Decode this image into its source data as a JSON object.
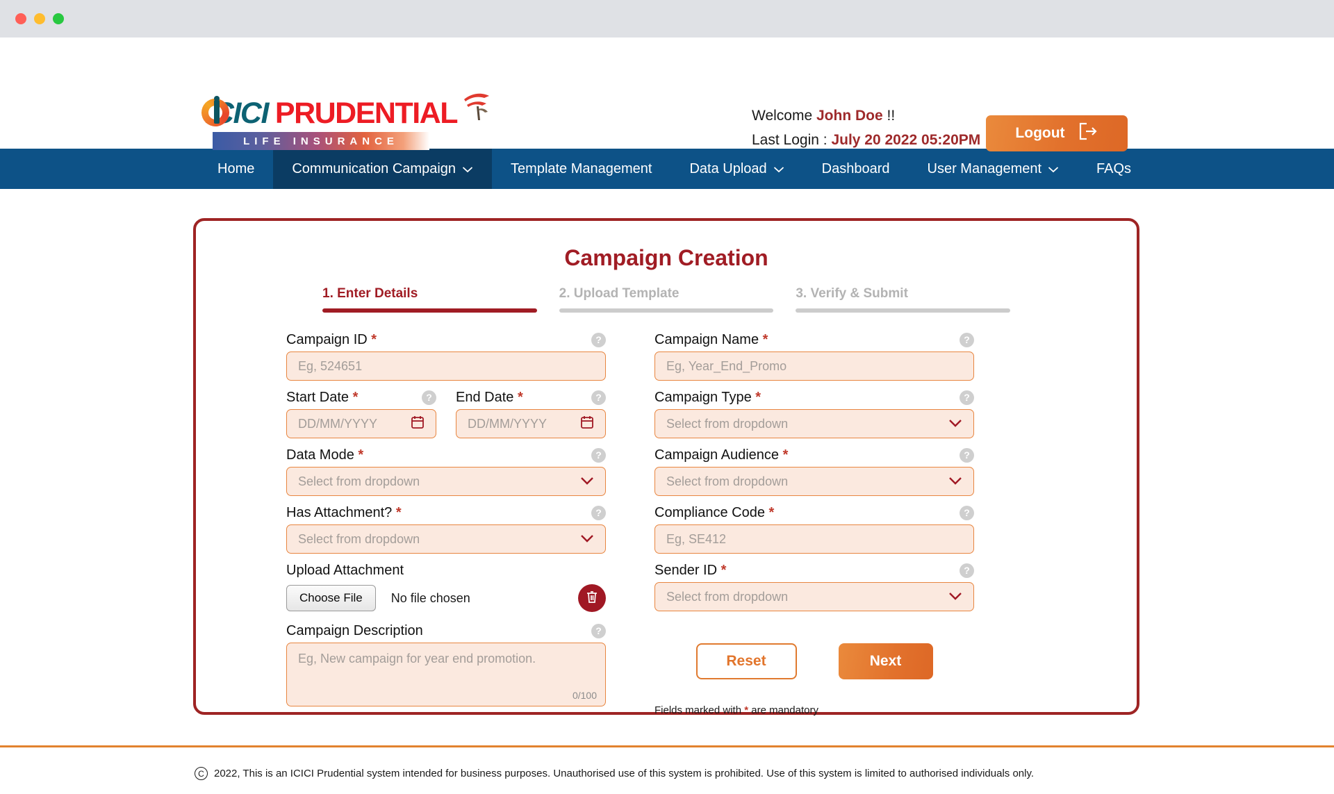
{
  "window": {
    "dots": [
      "close",
      "minimize",
      "maximize"
    ]
  },
  "header": {
    "brand": {
      "icici": "ICICI",
      "prudential": "PRUDENTIAL",
      "tagline": "LIFE INSURANCE"
    },
    "welcome_prefix": "Welcome",
    "user_name": "John Doe",
    "welcome_suffix": "!!",
    "last_login_label": "Last Login :",
    "last_login_value": "July 20 2022 05:20PM",
    "logout_label": "Logout"
  },
  "nav": {
    "items": [
      {
        "label": "Home",
        "caret": false,
        "active": false
      },
      {
        "label": "Communication Campaign",
        "caret": true,
        "active": true
      },
      {
        "label": "Template Management",
        "caret": false,
        "active": false
      },
      {
        "label": "Data Upload",
        "caret": true,
        "active": false
      },
      {
        "label": "Dashboard",
        "caret": false,
        "active": false
      },
      {
        "label": "User Management",
        "caret": true,
        "active": false
      },
      {
        "label": "FAQs",
        "caret": false,
        "active": false
      }
    ]
  },
  "card": {
    "title": "Campaign Creation",
    "steps": [
      {
        "label": "1. Enter Details",
        "active": true
      },
      {
        "label": "2. Upload Template",
        "active": false
      },
      {
        "label": "3. Verify & Submit",
        "active": false
      }
    ],
    "left": {
      "campaign_id": {
        "label": "Campaign ID",
        "required": "*",
        "placeholder": "Eg, 524651",
        "value": ""
      },
      "start_date": {
        "label": "Start Date",
        "required": "*",
        "placeholder": "DD/MM/YYYY",
        "value": ""
      },
      "end_date": {
        "label": "End Date",
        "required": "*",
        "placeholder": "DD/MM/YYYY",
        "value": ""
      },
      "data_mode": {
        "label": "Data Mode",
        "required": "*",
        "placeholder": "Select from dropdown",
        "value": ""
      },
      "has_attachment": {
        "label": "Has Attachment?",
        "required": "*",
        "placeholder": "Select from dropdown",
        "value": ""
      },
      "upload_attachment": {
        "label": "Upload Attachment",
        "choose_label": "Choose File",
        "file_status": "No file chosen"
      },
      "description": {
        "label": "Campaign Description",
        "placeholder": "Eg, New campaign for year end promotion.",
        "value": "",
        "counter": "0/100"
      }
    },
    "right": {
      "campaign_name": {
        "label": "Campaign Name",
        "required": "*",
        "placeholder": "Eg, Year_End_Promo",
        "value": ""
      },
      "campaign_type": {
        "label": "Campaign Type",
        "required": "*",
        "placeholder": "Select from dropdown",
        "value": ""
      },
      "campaign_audience": {
        "label": "Campaign Audience",
        "required": "*",
        "placeholder": "Select from dropdown",
        "value": ""
      },
      "compliance_code": {
        "label": "Compliance Code",
        "required": "*",
        "placeholder": "Eg, SE412",
        "value": ""
      },
      "sender_id": {
        "label": "Sender ID",
        "required": "*",
        "placeholder": "Select from dropdown",
        "value": ""
      },
      "reset_label": "Reset",
      "next_label": "Next",
      "mandatory_note_a": "Fields marked with",
      "mandatory_note_star": "*",
      "mandatory_note_b": "are mandatory"
    },
    "help_glyph": "?"
  },
  "footer": {
    "copyright_symbol": "C",
    "text": "2022, This is an ICICI Prudential system intended for business purposes. Unauthorised use of this system is prohibited. Use of this system is limited to authorised individuals only."
  },
  "colors": {
    "brand_red": "#a01c24",
    "brand_teal": "#0d6273",
    "nav_blue": "#0d5287",
    "nav_active": "#0b3c63",
    "accent_orange": "#e2752c",
    "field_fill": "#fbe9df",
    "field_border": "#e8853f"
  }
}
